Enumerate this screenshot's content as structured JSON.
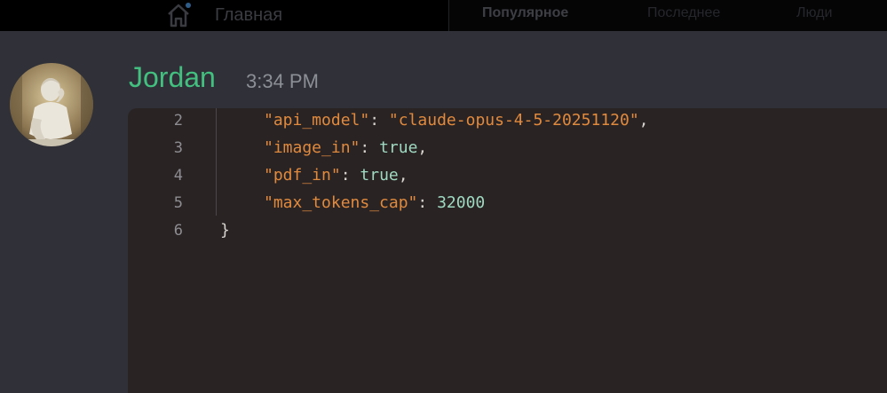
{
  "topbar": {
    "home_label": "Главная",
    "tabs": [
      {
        "label": "Популярное"
      },
      {
        "label": "Последнее"
      },
      {
        "label": "Люди"
      }
    ]
  },
  "message": {
    "author": "Jordan",
    "time": "3:34 PM",
    "author_color": "#43c07f"
  },
  "code": {
    "lines": [
      {
        "number": "2",
        "key": "\"api_model\"",
        "sep": ": ",
        "value": "\"claude-opus-4-5-20251120\"",
        "tail": ","
      },
      {
        "number": "3",
        "key": "\"image_in\"",
        "sep": ": ",
        "value": "true",
        "tail": ","
      },
      {
        "number": "4",
        "key": "\"pdf_in\"",
        "sep": ": ",
        "value": "true",
        "tail": ","
      },
      {
        "number": "5",
        "key": "\"max_tokens_cap\"",
        "sep": ": ",
        "value": "32000",
        "tail": ""
      },
      {
        "number": "6",
        "brace": "}"
      }
    ]
  },
  "colors": {
    "key": "#e08a3e",
    "literal": "#9ed9c1",
    "background": "#2a2324"
  }
}
